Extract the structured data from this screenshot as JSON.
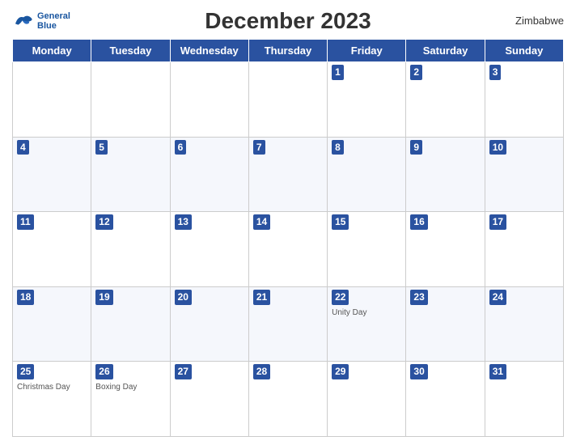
{
  "header": {
    "title": "December 2023",
    "country": "Zimbabwe",
    "logo": {
      "line1": "General",
      "line2": "Blue"
    }
  },
  "weekdays": [
    "Monday",
    "Tuesday",
    "Wednesday",
    "Thursday",
    "Friday",
    "Saturday",
    "Sunday"
  ],
  "weeks": [
    [
      {
        "day": "",
        "event": ""
      },
      {
        "day": "",
        "event": ""
      },
      {
        "day": "",
        "event": ""
      },
      {
        "day": "",
        "event": ""
      },
      {
        "day": "1",
        "event": ""
      },
      {
        "day": "2",
        "event": ""
      },
      {
        "day": "3",
        "event": ""
      }
    ],
    [
      {
        "day": "4",
        "event": ""
      },
      {
        "day": "5",
        "event": ""
      },
      {
        "day": "6",
        "event": ""
      },
      {
        "day": "7",
        "event": ""
      },
      {
        "day": "8",
        "event": ""
      },
      {
        "day": "9",
        "event": ""
      },
      {
        "day": "10",
        "event": ""
      }
    ],
    [
      {
        "day": "11",
        "event": ""
      },
      {
        "day": "12",
        "event": ""
      },
      {
        "day": "13",
        "event": ""
      },
      {
        "day": "14",
        "event": ""
      },
      {
        "day": "15",
        "event": ""
      },
      {
        "day": "16",
        "event": ""
      },
      {
        "day": "17",
        "event": ""
      }
    ],
    [
      {
        "day": "18",
        "event": ""
      },
      {
        "day": "19",
        "event": ""
      },
      {
        "day": "20",
        "event": ""
      },
      {
        "day": "21",
        "event": ""
      },
      {
        "day": "22",
        "event": "Unity Day"
      },
      {
        "day": "23",
        "event": ""
      },
      {
        "day": "24",
        "event": ""
      }
    ],
    [
      {
        "day": "25",
        "event": "Christmas Day"
      },
      {
        "day": "26",
        "event": "Boxing Day"
      },
      {
        "day": "27",
        "event": ""
      },
      {
        "day": "28",
        "event": ""
      },
      {
        "day": "29",
        "event": ""
      },
      {
        "day": "30",
        "event": ""
      },
      {
        "day": "31",
        "event": ""
      }
    ]
  ]
}
